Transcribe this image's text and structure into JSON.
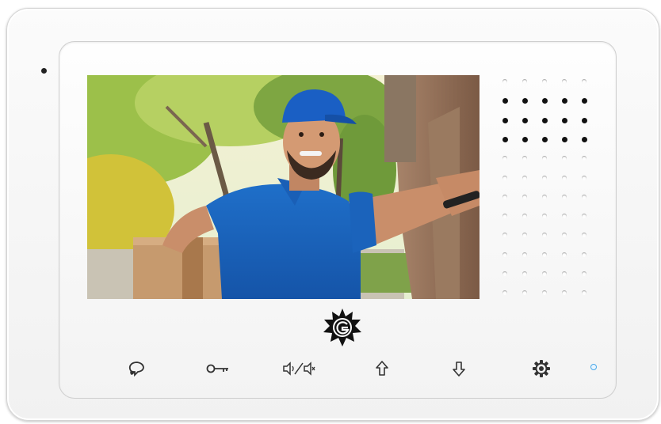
{
  "device": {
    "type": "video-intercom-monitor",
    "colors": {
      "body": "#f6f6f6",
      "led": "#4aa8e8",
      "icons": "#333333"
    }
  },
  "screen": {
    "content": "video-feed"
  },
  "speaker": {
    "rows": 12,
    "cols": 5,
    "dark_rows": [
      1,
      2,
      3
    ]
  },
  "buttons": [
    {
      "id": "intercom",
      "icon": "chat-bubble-icon"
    },
    {
      "id": "unlock",
      "icon": "key-icon"
    },
    {
      "id": "mute",
      "icon": "mute-toggle-icon"
    },
    {
      "id": "up",
      "icon": "arrow-up-icon"
    },
    {
      "id": "down",
      "icon": "arrow-down-icon"
    },
    {
      "id": "settings",
      "icon": "gear-icon"
    }
  ],
  "logo": {
    "icon": "brand-sun-logo-icon"
  },
  "status_led": {
    "color": "#4aa8e8",
    "state": "on"
  }
}
